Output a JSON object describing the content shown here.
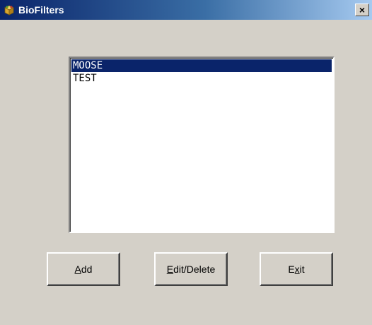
{
  "window": {
    "title": "BioFilters",
    "close_glyph": "×",
    "icon": "package-icon"
  },
  "list": {
    "items": [
      {
        "label": "MOOSE",
        "selected": true
      },
      {
        "label": "TEST",
        "selected": false
      }
    ]
  },
  "buttons": {
    "add": {
      "mnemonic": "A",
      "rest": "dd"
    },
    "edit_delete": {
      "mnemonic": "E",
      "rest": "dit/Delete"
    },
    "exit": {
      "before": "E",
      "mnemonic": "x",
      "rest": "it"
    }
  },
  "colors": {
    "selection": "#0a246a",
    "titlebar": "#0a246a",
    "face": "#d4d0c8"
  }
}
